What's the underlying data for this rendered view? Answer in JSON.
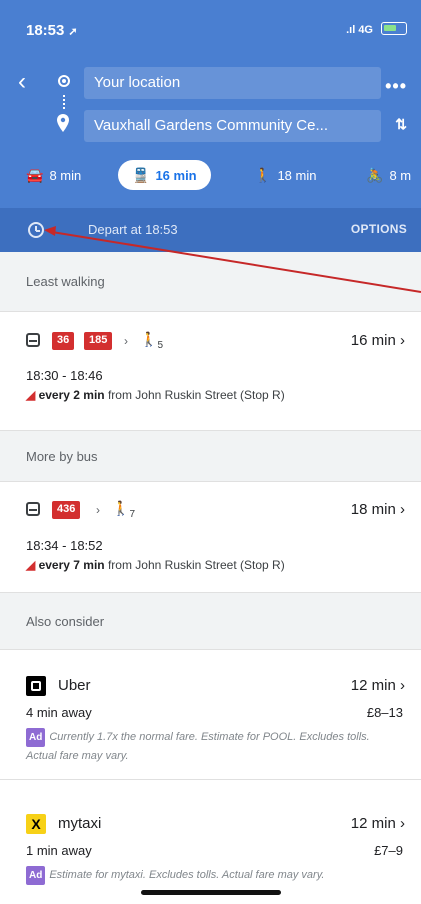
{
  "status_bar": {
    "time": "18:53",
    "network": "4G"
  },
  "search": {
    "origin": "Your location",
    "destination": "Vauxhall Gardens Community Ce..."
  },
  "modes": [
    {
      "icon": "car-icon",
      "label": "8 min"
    },
    {
      "icon": "transit-icon",
      "label": "16 min",
      "active": true
    },
    {
      "icon": "walk-icon",
      "label": "18 min"
    },
    {
      "icon": "cycle-icon",
      "label": "8 m"
    }
  ],
  "depart": {
    "label": "Depart at 18:53",
    "options": "OPTIONS"
  },
  "sections": {
    "least_walking": "Least walking",
    "more_by_bus": "More by bus",
    "also_consider": "Also consider"
  },
  "routes": [
    {
      "lines": [
        "36",
        "185"
      ],
      "walk_minutes": "5",
      "duration": "16 min",
      "times": "18:30 - 18:46",
      "frequency": "every 2 min",
      "from": "from John Ruskin Street (Stop R)"
    },
    {
      "lines": [
        "436"
      ],
      "walk_minutes": "7",
      "duration": "18 min",
      "times": "18:34 - 18:52",
      "frequency": "every 7 min",
      "from": "from John Ruskin Street (Stop R)"
    }
  ],
  "rides": [
    {
      "name": "Uber",
      "eta": "12 min",
      "away": "4 min away",
      "price": "£8–13",
      "ad": "Ad",
      "note": "Currently 1.7x the normal fare. Estimate for POOL. Excludes tolls. Actual fare may vary."
    },
    {
      "name": "mytaxi",
      "logo_text": "X",
      "eta": "12 min",
      "away": "1 min away",
      "price": "£7–9",
      "ad": "Ad",
      "note": "Estimate for mytaxi. Excludes tolls. Actual fare may vary."
    }
  ],
  "colors": {
    "header": "#4a7fd1",
    "depart_bar": "#3d6fbf",
    "bus_badge": "#d32f2f",
    "annotation_arrow": "#c62828"
  }
}
